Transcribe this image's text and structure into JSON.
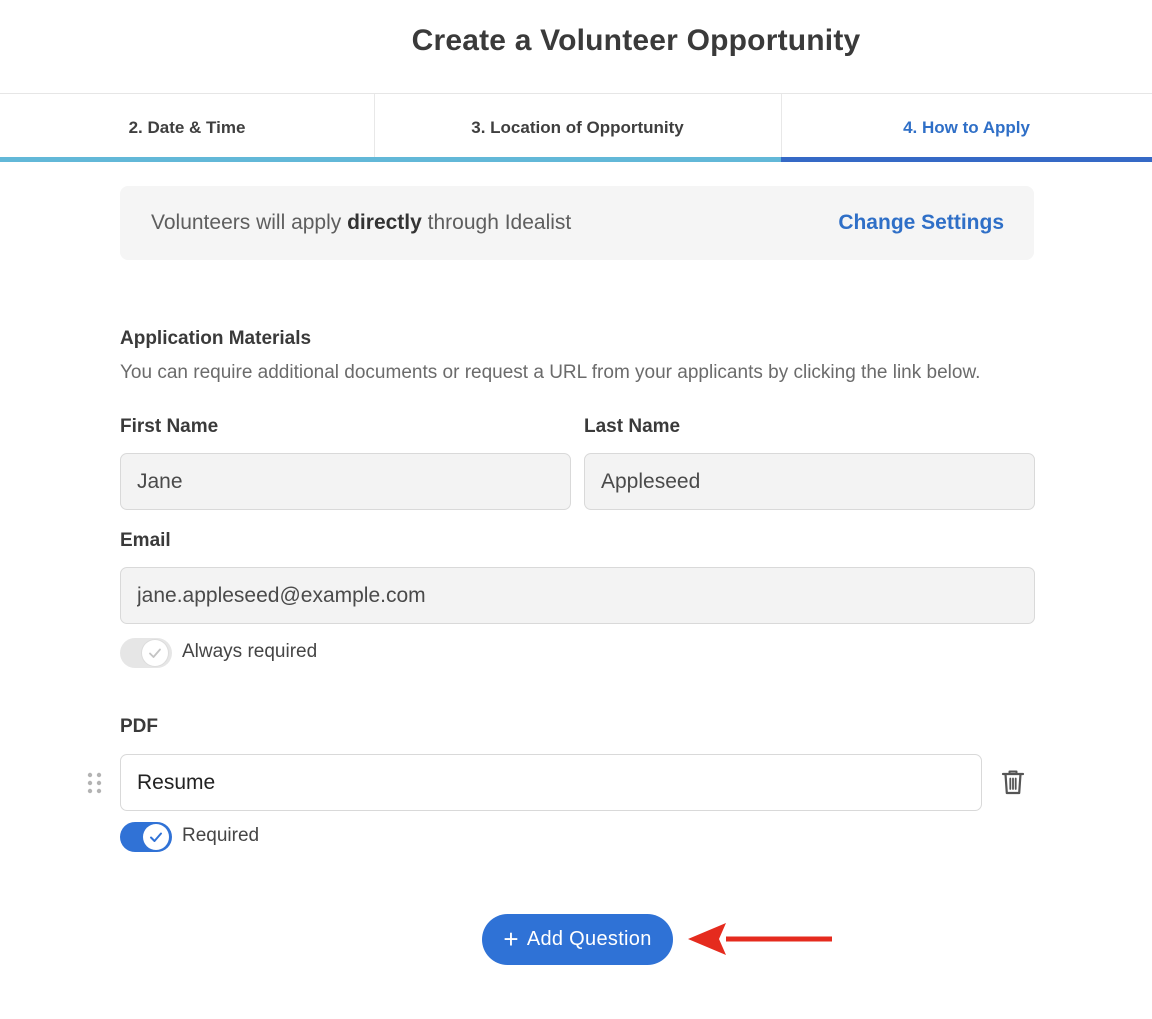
{
  "header": {
    "title": "Create a Volunteer Opportunity"
  },
  "tabs": [
    {
      "label": "2. Date & Time",
      "active": false
    },
    {
      "label": "3. Location of Opportunity",
      "active": false
    },
    {
      "label": "4. How to Apply",
      "active": true
    }
  ],
  "info_box": {
    "text_before": "Volunteers will apply ",
    "text_bold": "directly",
    "text_after": " through Idealist",
    "link_label": "Change Settings"
  },
  "application_materials": {
    "heading": "Application Materials",
    "description": "You can require additional documents or request a URL from your applicants by clicking the link below."
  },
  "fields": {
    "first_name": {
      "label": "First Name",
      "value": "Jane"
    },
    "last_name": {
      "label": "Last Name",
      "value": "Appleseed"
    },
    "email": {
      "label": "Email",
      "value": "jane.appleseed@example.com"
    },
    "email_toggle": {
      "label": "Always required",
      "checked": true,
      "disabled": true
    }
  },
  "pdf_question": {
    "label": "PDF",
    "value": "Resume",
    "toggle_label": "Required",
    "required": true
  },
  "actions": {
    "add_question_label": "Add Question",
    "add_question_icon": "plus-icon"
  },
  "colors": {
    "accent": "#2f72d6",
    "active_tab": "#2f6fc7",
    "progress_bar": "#62b8d8",
    "annotation_arrow": "#e52b1e"
  }
}
